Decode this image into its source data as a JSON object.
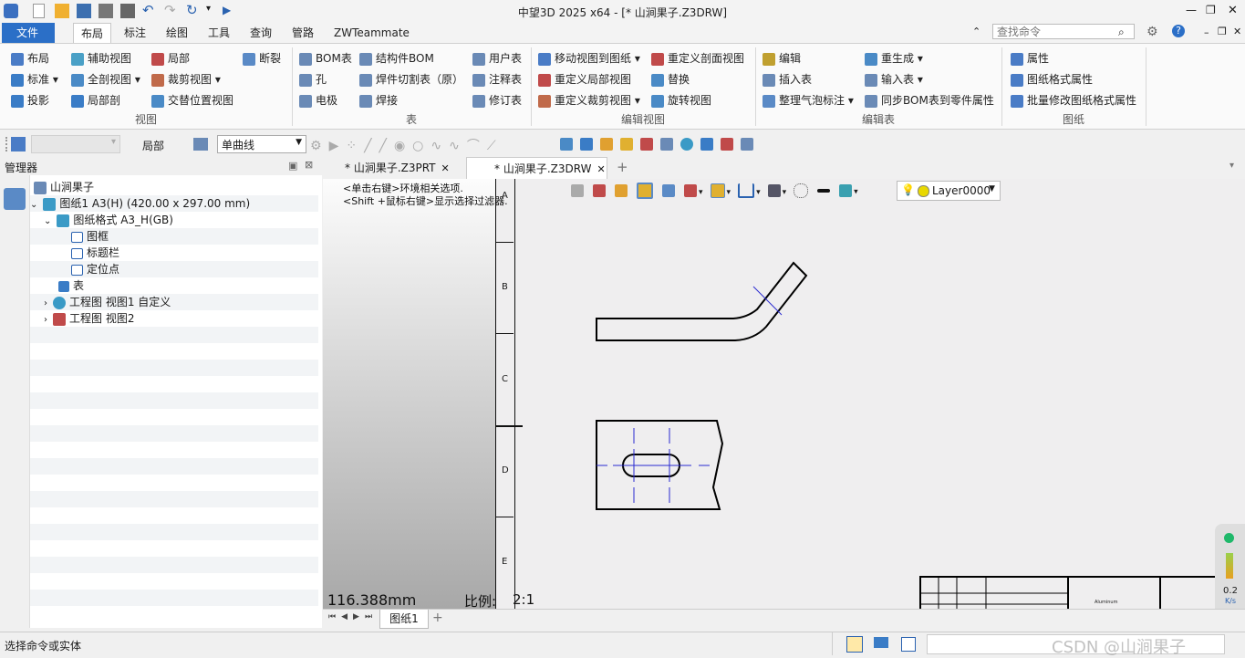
{
  "window": {
    "title": "中望3D 2025 x64 - [* 山涧果子.Z3DRW]"
  },
  "menu": {
    "file": "文件(F)",
    "tabs": [
      "布局",
      "标注",
      "绘图",
      "工具",
      "查询",
      "管路",
      "ZWTeammate"
    ],
    "search_placeholder": "查找命令"
  },
  "ribbon": {
    "view_group": {
      "label": "视图",
      "items": [
        "布局",
        "辅助视图",
        "局部",
        "断裂",
        "标准",
        "全剖视图",
        "裁剪视图",
        "投影",
        "局部剖",
        "交替位置视图"
      ]
    },
    "table_group": {
      "label": "表",
      "items": [
        "BOM表",
        "结构件BOM",
        "用户表",
        "孔",
        "焊件切割表（原）",
        "注释表",
        "电极",
        "焊接",
        "修订表"
      ]
    },
    "edit_view_group": {
      "label": "编辑视图",
      "items": [
        "移动视图到图纸",
        "重定义剖面视图",
        "重定义局部视图",
        "替换",
        "重定义裁剪视图",
        "旋转视图"
      ]
    },
    "edit_table_group": {
      "label": "编辑表",
      "items": [
        "编辑",
        "重生成",
        "插入表",
        "输入表",
        "整理气泡标注",
        "同步BOM表到零件属性"
      ]
    },
    "sheet_group": {
      "label": "图纸",
      "items": [
        "属性",
        "图纸格式属性",
        "批量修改图纸格式属性"
      ]
    }
  },
  "toolbar2": {
    "part_label": "局部",
    "curve_select": "单曲线"
  },
  "manager": {
    "title": "管理器",
    "tree": [
      "山涧果子",
      "图纸1 A3(H) (420.00 x 297.00 mm)",
      "图纸格式 A3_H(GB)",
      "图框",
      "标题栏",
      "定位点",
      "表",
      "工程图 视图1 自定义",
      "工程图 视图2"
    ]
  },
  "doc_tabs": [
    "* 山涧果子.Z3PRT",
    "* 山涧果子.Z3DRW"
  ],
  "canvas": {
    "hint1": "<单击右键>环境相关选项.",
    "hint2": "<Shift +鼠标右键>显示选择过滤器.",
    "layer": "Layer0000",
    "measure": "116.388mm",
    "scale_label": "比例:",
    "scale_value": "2:1",
    "zones": [
      "A",
      "B",
      "C",
      "D",
      "E"
    ],
    "title_block_text": "Aluminum"
  },
  "sheet_tabs": [
    "图纸1"
  ],
  "status": {
    "prompt": "选择命令或实体",
    "speed_value": "0.2",
    "speed_unit": "K/s"
  },
  "watermark": "CSDN @山涧果子"
}
